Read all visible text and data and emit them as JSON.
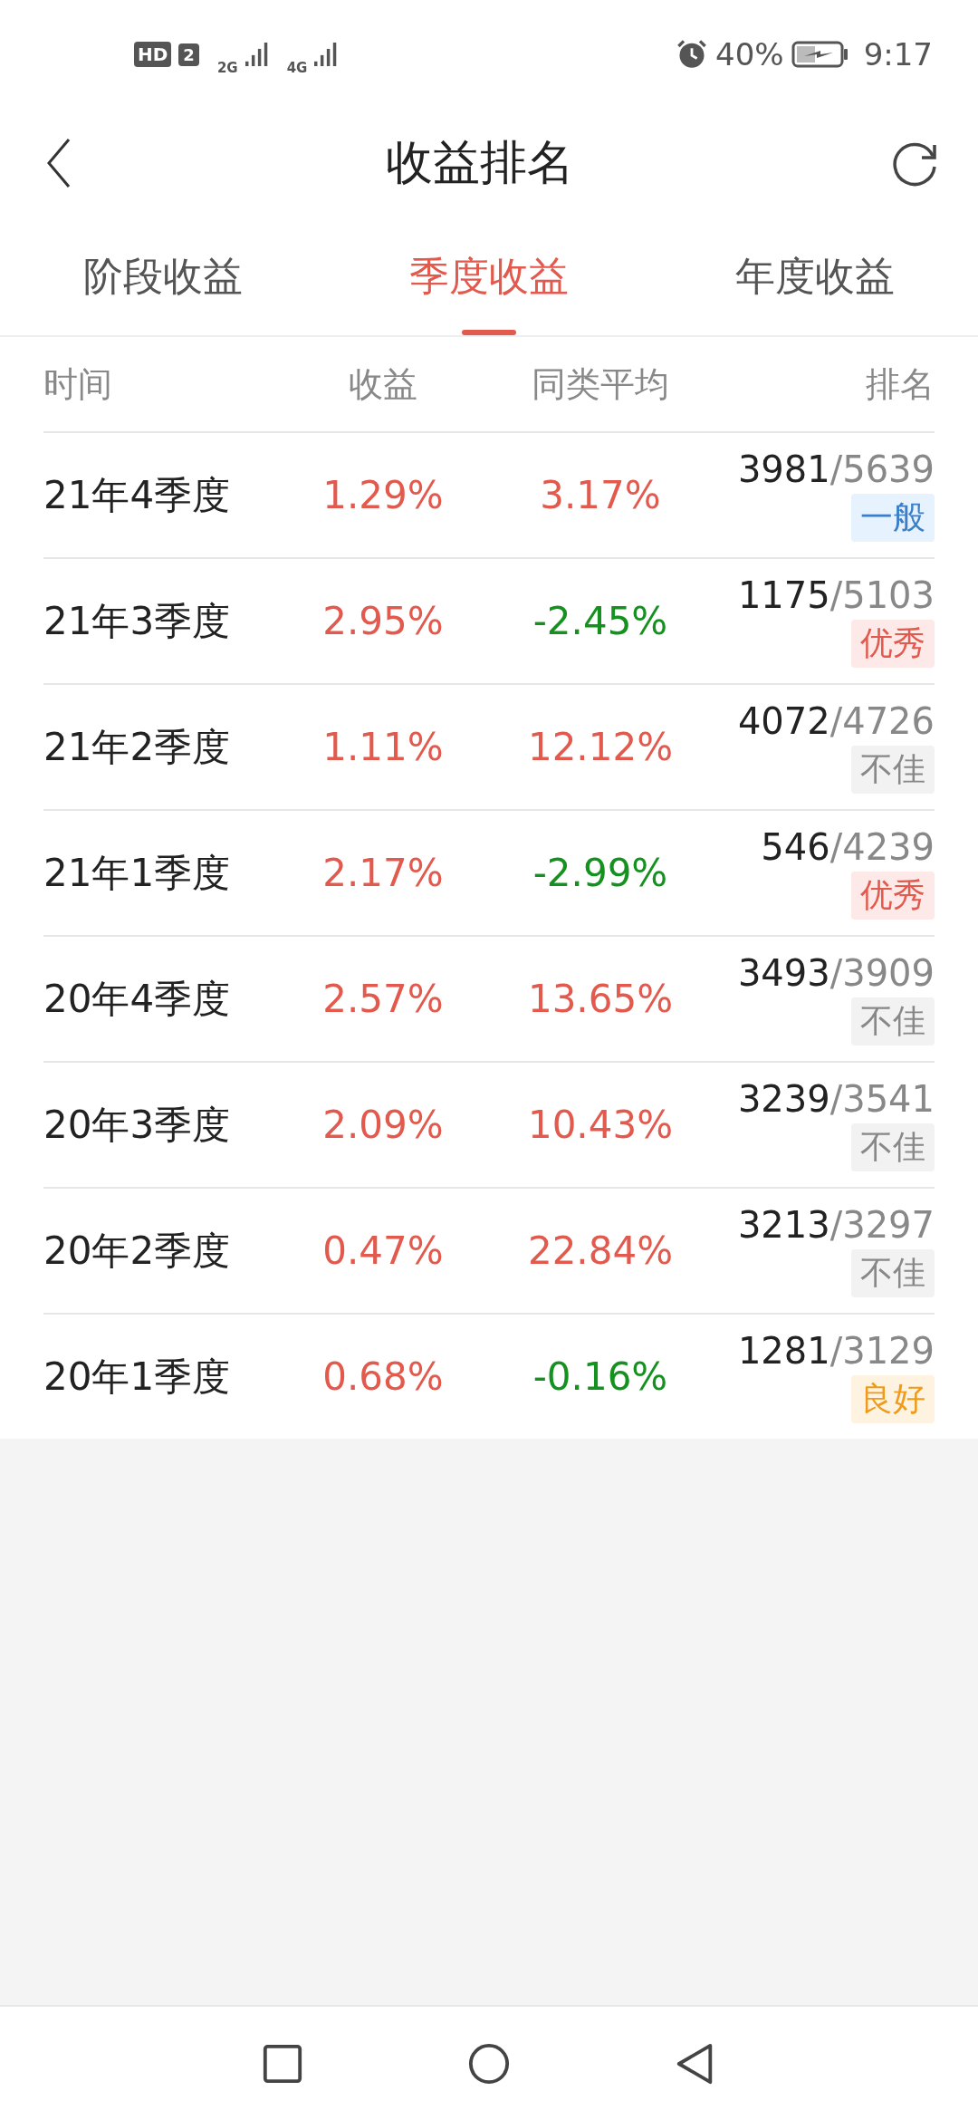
{
  "status_bar": {
    "hd": "HD",
    "sim": "2",
    "net_1": "2G",
    "net_2": "4G",
    "battery": "40%",
    "time": "9:17"
  },
  "header": {
    "title": "收益排名"
  },
  "tabs": [
    {
      "label": "阶段收益",
      "selected": false
    },
    {
      "label": "季度收益",
      "selected": true
    },
    {
      "label": "年度收益",
      "selected": false
    }
  ],
  "table": {
    "columns": [
      "时间",
      "收益",
      "同类平均",
      "排名"
    ],
    "rows": [
      {
        "period": "21年4季度",
        "return": {
          "text": "1.29%",
          "color": "#e2594d"
        },
        "average": {
          "text": "3.17%",
          "color": "#e2594d"
        },
        "rank": "3981",
        "total": "/5639",
        "rating": {
          "text": "一般",
          "kind": "average"
        }
      },
      {
        "period": "21年3季度",
        "return": {
          "text": "2.95%",
          "color": "#e2594d"
        },
        "average": {
          "text": "-2.45%",
          "color": "#14911f"
        },
        "rank": "1175",
        "total": "/5103",
        "rating": {
          "text": "优秀",
          "kind": "excellent"
        }
      },
      {
        "period": "21年2季度",
        "return": {
          "text": "1.11%",
          "color": "#e2594d"
        },
        "average": {
          "text": "12.12%",
          "color": "#e2594d"
        },
        "rank": "4072",
        "total": "/4726",
        "rating": {
          "text": "不佳",
          "kind": "poor"
        }
      },
      {
        "period": "21年1季度",
        "return": {
          "text": "2.17%",
          "color": "#e2594d"
        },
        "average": {
          "text": "-2.99%",
          "color": "#14911f"
        },
        "rank": "546",
        "total": "/4239",
        "rating": {
          "text": "优秀",
          "kind": "excellent"
        }
      },
      {
        "period": "20年4季度",
        "return": {
          "text": "2.57%",
          "color": "#e2594d"
        },
        "average": {
          "text": "13.65%",
          "color": "#e2594d"
        },
        "rank": "3493",
        "total": "/3909",
        "rating": {
          "text": "不佳",
          "kind": "poor"
        }
      },
      {
        "period": "20年3季度",
        "return": {
          "text": "2.09%",
          "color": "#e2594d"
        },
        "average": {
          "text": "10.43%",
          "color": "#e2594d"
        },
        "rank": "3239",
        "total": "/3541",
        "rating": {
          "text": "不佳",
          "kind": "poor"
        }
      },
      {
        "period": "20年2季度",
        "return": {
          "text": "0.47%",
          "color": "#e2594d"
        },
        "average": {
          "text": "22.84%",
          "color": "#e2594d"
        },
        "rank": "3213",
        "total": "/3297",
        "rating": {
          "text": "不佳",
          "kind": "poor"
        }
      },
      {
        "period": "20年1季度",
        "return": {
          "text": "0.68%",
          "color": "#e2594d"
        },
        "average": {
          "text": "-0.16%",
          "color": "#14911f"
        },
        "rank": "1281",
        "total": "/3129",
        "rating": {
          "text": "良好",
          "kind": "good"
        }
      }
    ]
  }
}
